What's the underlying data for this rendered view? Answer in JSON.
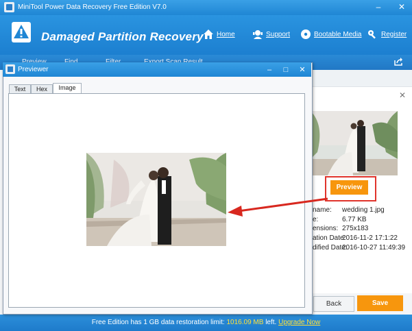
{
  "window": {
    "title": "MiniTool Power Data Recovery Free Edition V7.0"
  },
  "header": {
    "app_title": "Damaged Partition Recovery",
    "nav": [
      {
        "label": "Home",
        "icon": "home-icon"
      },
      {
        "label": "Support",
        "icon": "support-icon"
      },
      {
        "label": "Bootable Media",
        "icon": "disc-icon"
      },
      {
        "label": "Register",
        "icon": "key-icon"
      }
    ]
  },
  "toolbar": {
    "items": [
      {
        "label": "Preview",
        "icon": "eye-icon"
      },
      {
        "label": "Find",
        "icon": "search-icon"
      },
      {
        "label": "Filter",
        "icon": "filter-icon"
      },
      {
        "label": "Export Scan Result",
        "icon": "export-icon"
      }
    ]
  },
  "dialog": {
    "title": "Previewer",
    "tabs": [
      "Text",
      "Hex",
      "Image"
    ],
    "active_tab": "Image"
  },
  "details": {
    "preview_button": "Preview",
    "properties": [
      {
        "label": "name:",
        "value": "wedding 1.jpg"
      },
      {
        "label": "e:",
        "value": "6.77 KB"
      },
      {
        "label": "ensions:",
        "value": "275x183"
      },
      {
        "label": "ation Date:",
        "value": "2016-11-2 17:1:22"
      },
      {
        "label": "dified Date:",
        "value": "2016-10-27 11:49:39"
      }
    ]
  },
  "footer": {
    "back_label": "Back",
    "save_label": "Save",
    "status_prefix": "Free Edition has 1 GB data restoration limit:",
    "status_remaining": "1016.09 MB",
    "status_left": "left.",
    "upgrade_link": "Upgrade Now"
  },
  "colors": {
    "header_blue": "#1f86d4",
    "accent_orange": "#f7960d",
    "highlight_red": "#e0332b",
    "status_yellow": "#ffe03a"
  }
}
